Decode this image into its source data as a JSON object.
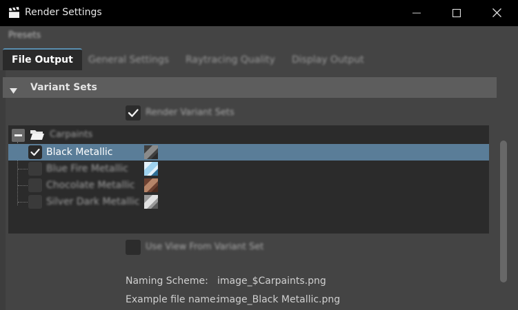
{
  "window": {
    "title": "Render Settings",
    "app_icon": "clapperboard-icon",
    "minimize_icon": "minimize-icon",
    "maximize_icon": "maximize-icon",
    "close_icon": "close-icon"
  },
  "menu": {
    "presets": "Presets"
  },
  "tabs": [
    {
      "label": "File Output",
      "active": true
    },
    {
      "label": "General Settings",
      "active": false
    },
    {
      "label": "Raytracing Quality",
      "active": false
    },
    {
      "label": "Display Output",
      "active": false
    }
  ],
  "section": {
    "title": "Variant Sets",
    "expanded": true
  },
  "render_variant_sets": {
    "label": "Render Variant Sets",
    "checked": true
  },
  "tree": {
    "group": {
      "label": "Carpaints",
      "expanded": true,
      "icon": "folder-open-icon"
    },
    "items": [
      {
        "label": "Black Metallic",
        "checked": true,
        "selected": true,
        "swatch": "#4a4a4a"
      },
      {
        "label": "Blue Fire Metallic",
        "checked": false,
        "selected": false,
        "swatch": "#cfe6f2"
      },
      {
        "label": "Chocolate Metallic",
        "checked": false,
        "selected": false,
        "swatch": "#8a5a42"
      },
      {
        "label": "Silver Dark Metallic",
        "checked": false,
        "selected": false,
        "swatch": "#b8b8b8"
      }
    ]
  },
  "use_view": {
    "label": "Use View From Variant Set",
    "checked": false
  },
  "naming": {
    "scheme_label": "Naming Scheme:",
    "scheme_value": "image_$Carpaints.png",
    "example_label": "Example file name:",
    "example_value": "image_Black Metallic.png"
  },
  "colors": {
    "titlebar": "#000000",
    "background": "#444444",
    "selection": "#5a7d98",
    "tab_accent": "#5a8fb0"
  }
}
